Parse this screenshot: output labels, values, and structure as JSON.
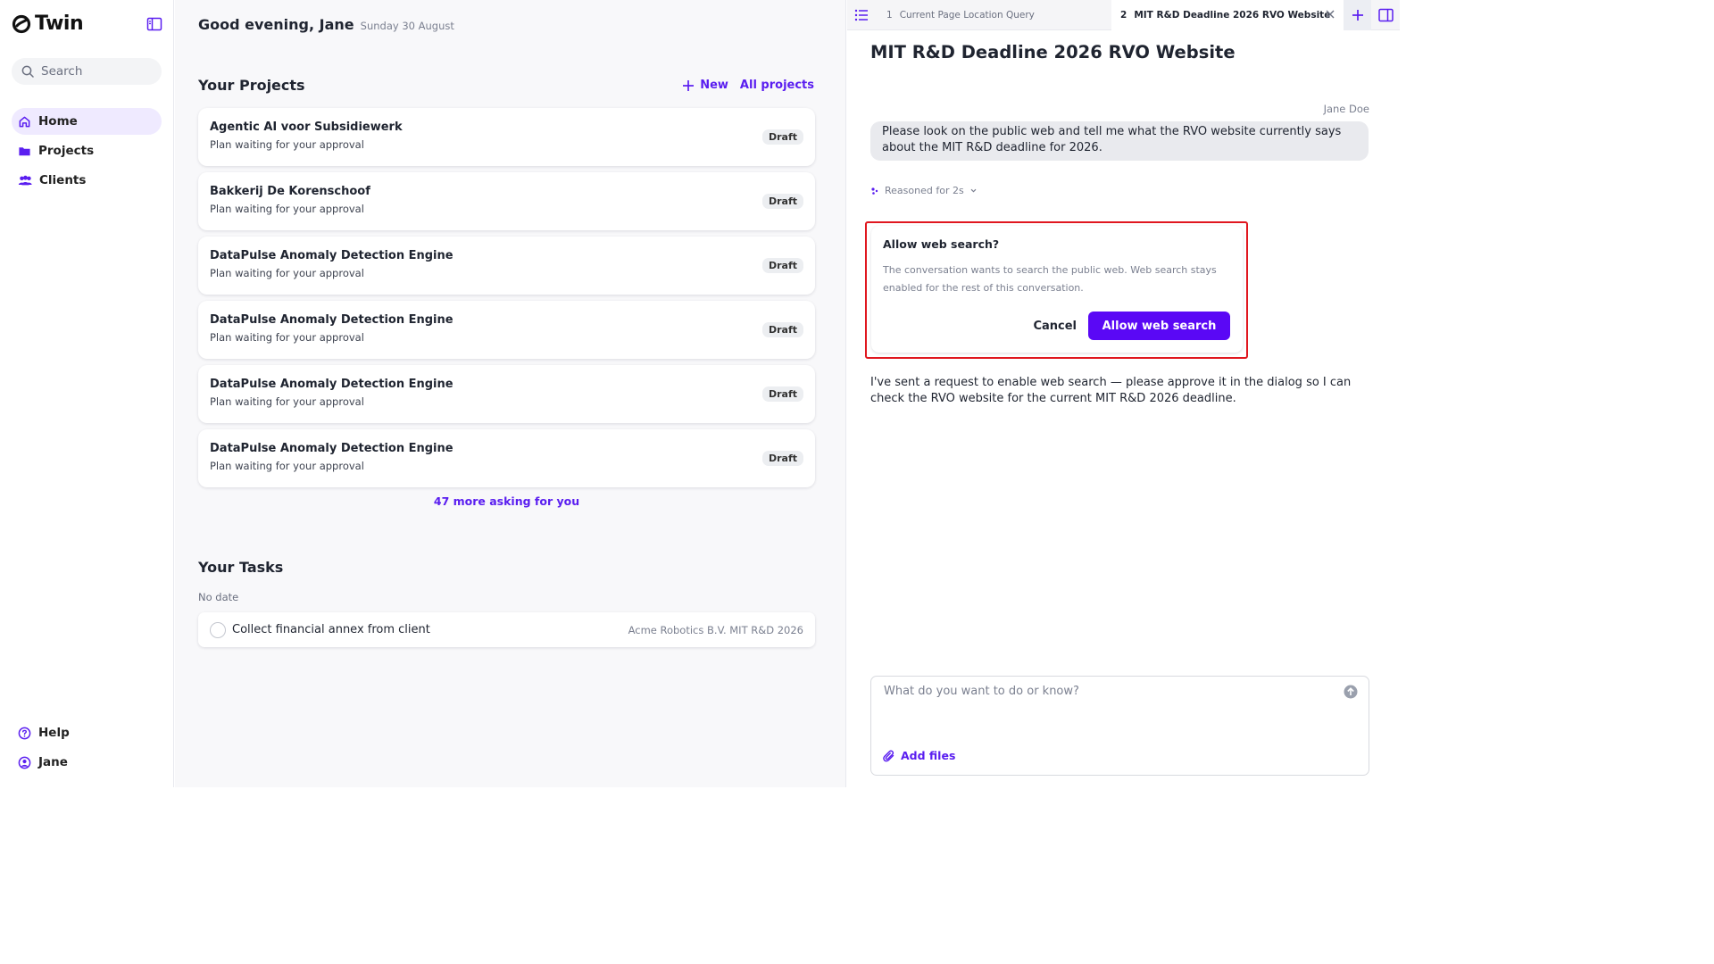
{
  "app": {
    "name": "Twin"
  },
  "sidebar": {
    "search_placeholder": "Search",
    "items": [
      {
        "label": "Home",
        "icon": "home-icon",
        "active": true
      },
      {
        "label": "Projects",
        "icon": "folder-icon"
      },
      {
        "label": "Clients",
        "icon": "users-icon"
      }
    ],
    "bottom": [
      {
        "label": "Help",
        "icon": "help-icon"
      },
      {
        "label": "Jane",
        "icon": "user-icon"
      }
    ]
  },
  "home": {
    "greeting": "Good evening, Jane",
    "date": "Sunday 30 August",
    "projects_title": "Your Projects",
    "new_label": "New",
    "all_projects_label": "All projects",
    "projects": [
      {
        "name": "Agentic AI voor Subsidiewerk",
        "subtitle": "Plan waiting for your approval",
        "status": "Draft"
      },
      {
        "name": "Bakkerij De Korenschoof",
        "subtitle": "Plan waiting for your approval",
        "status": "Draft"
      },
      {
        "name": "DataPulse Anomaly Detection Engine",
        "subtitle": "Plan waiting for your approval",
        "status": "Draft"
      },
      {
        "name": "DataPulse Anomaly Detection Engine",
        "subtitle": "Plan waiting for your approval",
        "status": "Draft"
      },
      {
        "name": "DataPulse Anomaly Detection Engine",
        "subtitle": "Plan waiting for your approval",
        "status": "Draft"
      },
      {
        "name": "DataPulse Anomaly Detection Engine",
        "subtitle": "Plan waiting for your approval",
        "status": "Draft"
      }
    ],
    "more_label": "47 more asking for you",
    "tasks_title": "Your Tasks",
    "no_date_label": "No date",
    "tasks": [
      {
        "title": "Collect financial annex from client",
        "meta": "Acme Robotics B.V. MIT R&D 2026"
      }
    ]
  },
  "chat": {
    "tabs": [
      {
        "number": "1",
        "title": "Current Page Location Query"
      },
      {
        "number": "2",
        "title": "MIT R&D Deadline 2026 RVO Website",
        "active": true
      }
    ],
    "title": "MIT R&D Deadline 2026 RVO Website",
    "user_name": "Jane Doe",
    "user_message": "Please look on the public web and tell me what the RVO website currently says about the MIT R&D deadline for 2026.",
    "reasoned_label": "Reasoned for 2s",
    "dialog": {
      "title": "Allow web search?",
      "body": "The conversation wants to search the public web. Web search stays enabled for the rest of this conversation.",
      "cancel_label": "Cancel",
      "allow_label": "Allow web search"
    },
    "assistant_message": "I've sent a request to enable web search — please approve it in the dialog so I can check the RVO website for the current MIT R&D 2026 deadline.",
    "composer": {
      "placeholder": "What do you want to do or know?",
      "add_files_label": "Add files"
    }
  },
  "colors": {
    "accent": "#5a1ef0",
    "button_primary": "#5a08f5",
    "highlight_border": "#e0171f",
    "nav_active_bg": "#efeaff"
  }
}
